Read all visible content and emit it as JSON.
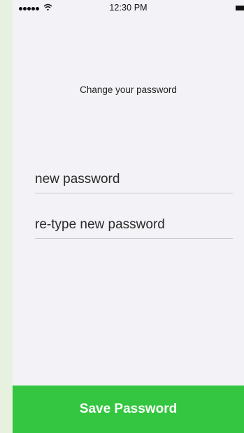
{
  "status_bar": {
    "time": "12:30 PM",
    "signal_icon": "signal-dots-icon",
    "wifi_icon": "wifi-icon",
    "battery_icon": "battery-icon"
  },
  "screen": {
    "title": "Change your password"
  },
  "form": {
    "new_password": {
      "placeholder": "new password",
      "value": ""
    },
    "retype_password": {
      "placeholder": "re-type new password",
      "value": ""
    }
  },
  "actions": {
    "save_label": "Save Password"
  },
  "colors": {
    "backdrop": "#e7f1df",
    "screen_background": "#f2f2f7",
    "button_green": "#34c640",
    "button_text": "#ffffff",
    "field_divider": "#c9cad3"
  }
}
